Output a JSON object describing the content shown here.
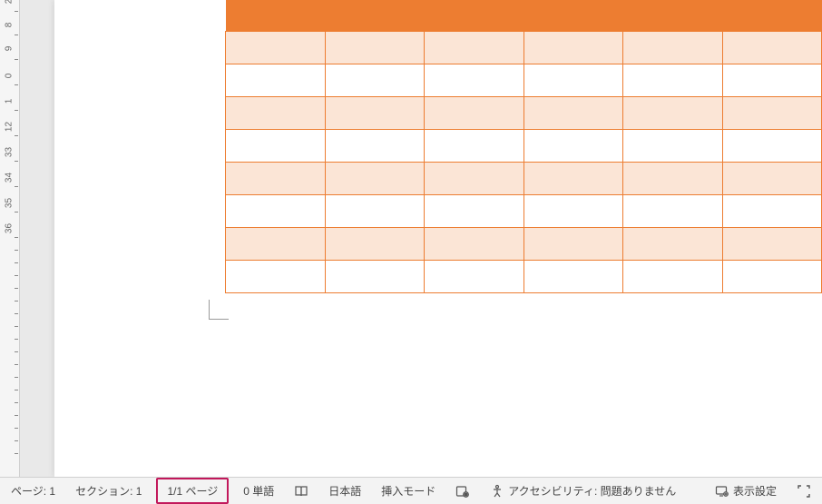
{
  "ruler": {
    "labels": [
      "2",
      "8",
      "9",
      "0",
      "1",
      "12",
      "33",
      "34",
      "35",
      "36"
    ]
  },
  "table": {
    "columns": 6,
    "rows": 8
  },
  "status": {
    "page": "ページ: 1",
    "section": "セクション: 1",
    "page_count": "1/1 ページ",
    "words": "0 単語",
    "language": "日本語",
    "insert_mode": "挿入モード",
    "accessibility": "アクセシビリティ: 問題ありません",
    "display_settings": "表示設定"
  }
}
